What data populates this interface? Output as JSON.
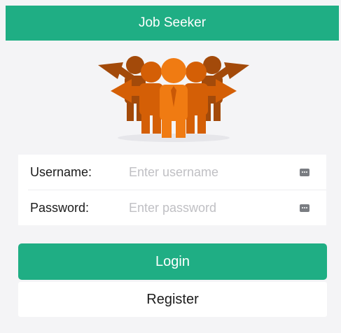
{
  "header": {
    "title": "Job Seeker"
  },
  "logo": {
    "icon": "team-people-arrows-icon",
    "colors": {
      "back": "#a34a0a",
      "middle": "#d45f06",
      "front": "#f07b12"
    }
  },
  "form": {
    "username": {
      "label": "Username:",
      "placeholder": "Enter username",
      "value": ""
    },
    "password": {
      "label": "Password:",
      "placeholder": "Enter password",
      "value": ""
    }
  },
  "buttons": {
    "login_label": "Login",
    "register_label": "Register"
  },
  "colors": {
    "accent": "#1fae84",
    "background": "#f4f4f6",
    "card": "#ffffff"
  }
}
